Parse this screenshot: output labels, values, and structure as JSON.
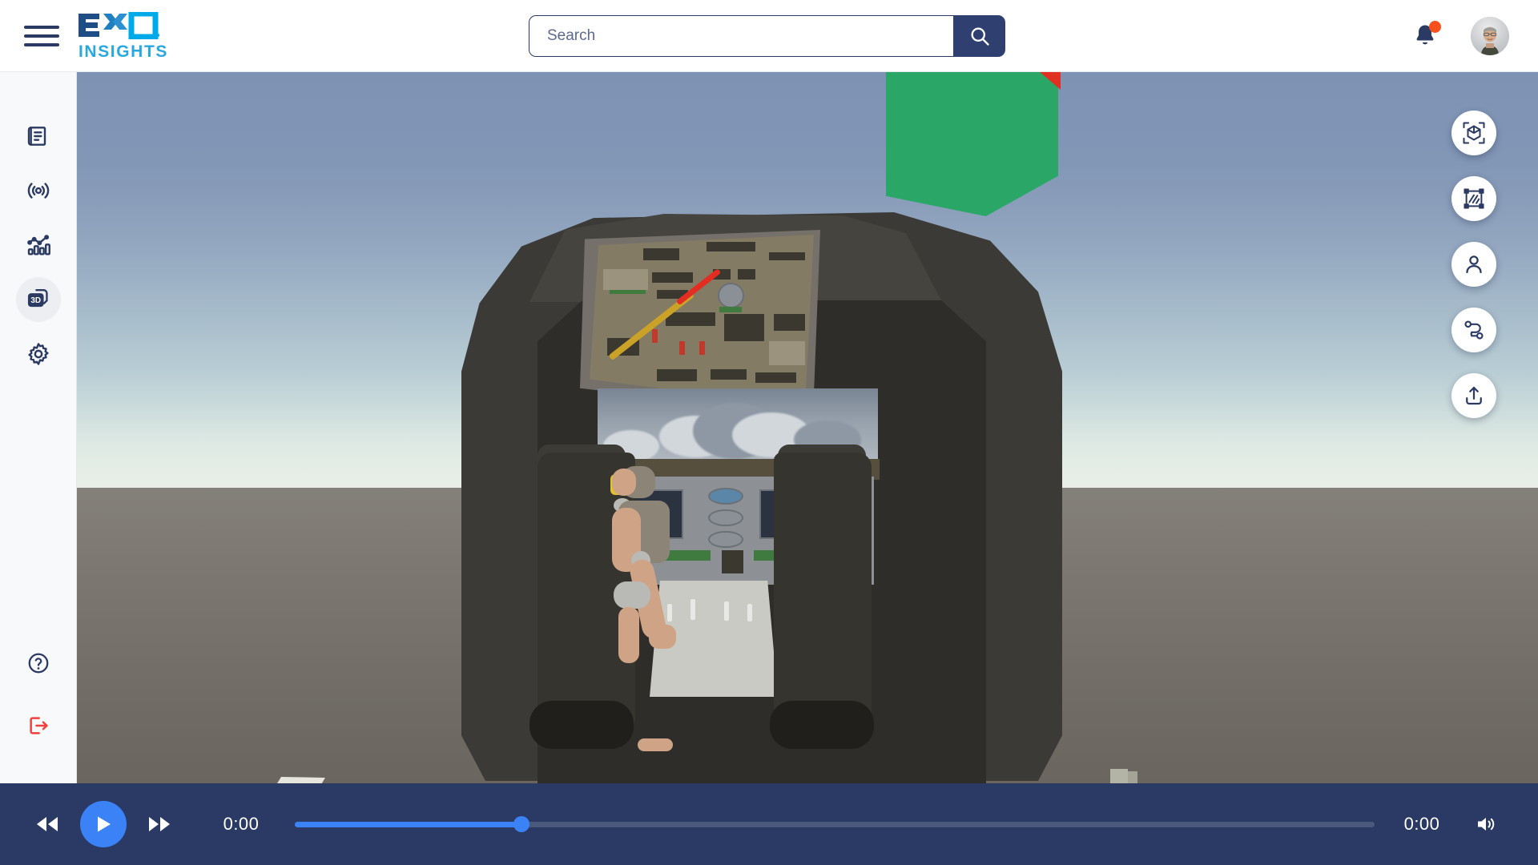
{
  "header": {
    "menu_icon": "hamburger-menu-icon",
    "brand": {
      "name": "EXO",
      "tagline": "INSIGHTS"
    },
    "search": {
      "value": "",
      "placeholder": "Search",
      "button_icon": "search-icon"
    },
    "notifications": {
      "icon": "bell-icon",
      "has_unread": true,
      "dot_color": "#f6511d"
    },
    "avatar": {
      "icon": "user-avatar"
    }
  },
  "sidebar": {
    "items": [
      {
        "name": "sidebar-item-reports",
        "icon": "document-book-icon",
        "active": false
      },
      {
        "name": "sidebar-item-live",
        "icon": "broadcast-signal-icon",
        "active": false
      },
      {
        "name": "sidebar-item-analytics",
        "icon": "analytics-chart-icon",
        "active": false
      },
      {
        "name": "sidebar-item-3d",
        "icon": "3d-layers-icon",
        "label": "3D",
        "active": true
      },
      {
        "name": "sidebar-item-settings",
        "icon": "gear-icon",
        "active": false
      }
    ],
    "bottom_items": [
      {
        "name": "sidebar-item-help",
        "icon": "question-circle-icon",
        "color": "#2b3a62"
      },
      {
        "name": "sidebar-item-logout",
        "icon": "logout-icon",
        "color": "#f43f3f"
      }
    ]
  },
  "viewport": {
    "tools": [
      {
        "name": "tool-bounding-box",
        "icon": "3d-bounding-box-icon"
      },
      {
        "name": "tool-area-select",
        "icon": "crop-area-icon"
      },
      {
        "name": "tool-person-view",
        "icon": "person-icon"
      },
      {
        "name": "tool-path-trace",
        "icon": "node-path-icon"
      },
      {
        "name": "tool-export",
        "icon": "upload-share-icon"
      }
    ],
    "scene": {
      "description": "3D aircraft cockpit simulation with seated mannequin and gaze ray",
      "sky_top_color": "#7e93b4",
      "horizon_color": "#e2ece6",
      "ground_color": "#7c7771",
      "marker_plane_color": "#2aa767",
      "marker_accent_color": "#e03022",
      "gaze_ray_colors": [
        "#c9a227",
        "#e32d22"
      ]
    }
  },
  "player": {
    "rewind_icon": "rewind-icon",
    "play_icon": "play-icon",
    "forward_icon": "fast-forward-icon",
    "current_time": "0:00",
    "duration": "0:00",
    "progress_percent": 21,
    "volume_icon": "volume-icon",
    "accent_color": "#3b82f6",
    "bar_color": "#2a3a64"
  }
}
